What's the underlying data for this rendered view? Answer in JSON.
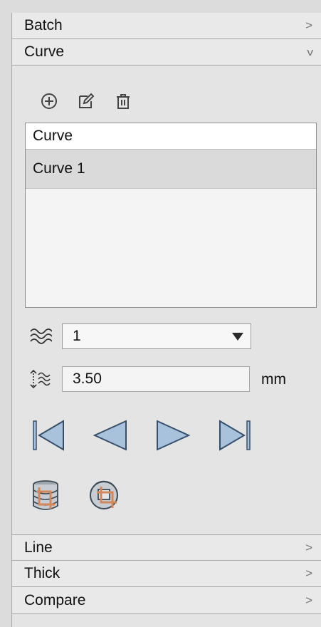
{
  "sections": {
    "batch": {
      "label": "Batch",
      "chevron": ">"
    },
    "curve": {
      "label": "Curve",
      "chevron": "v"
    },
    "line": {
      "label": "Line",
      "chevron": ">"
    },
    "thick": {
      "label": "Thick",
      "chevron": ">"
    },
    "compare": {
      "label": "Compare",
      "chevron": ">"
    }
  },
  "curve_panel": {
    "toolbar_icons": [
      "add-circle-icon",
      "edit-icon",
      "trash-icon"
    ],
    "list": {
      "header": "Curve",
      "items": [
        {
          "label": "Curve 1",
          "selected": true
        }
      ]
    },
    "smoothing": {
      "icon": "waves-icon",
      "value": "1"
    },
    "offset": {
      "icon": "vertical-offset-waves-icon",
      "value": "3.50",
      "unit": "mm"
    },
    "navigation": [
      "first-icon",
      "prev-icon",
      "next-icon",
      "last-icon"
    ],
    "actions": [
      "layer-stack-crop-icon",
      "crop-rotate-icon"
    ]
  },
  "colors": {
    "panel_bg": "#e4e4e4",
    "header_bg": "#e9e9e9",
    "selected_row": "#dadada",
    "nav_fill": "#a9c2db",
    "nav_stroke": "#36506b",
    "action_orange": "#d4875a"
  }
}
